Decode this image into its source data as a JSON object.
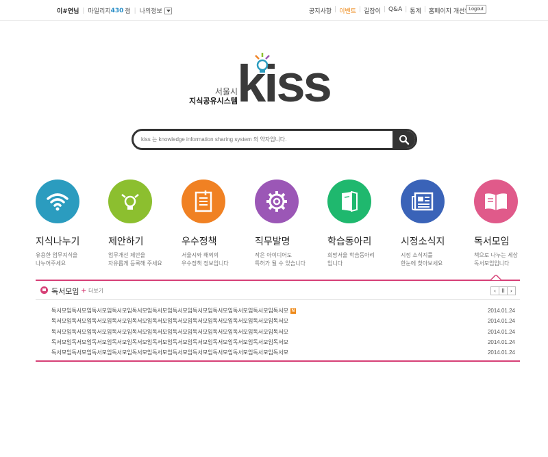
{
  "topbar": {
    "user_name": "이#연님",
    "mileage_label": "마일리지",
    "mileage_value": "430",
    "mileage_unit": "점",
    "myinfo_label": "나의정보",
    "nav": [
      "공지사항",
      "이벤트",
      "길잡이",
      "Q&A",
      "통계",
      "홈페이지 개선의견"
    ],
    "logout_label": "Logout",
    "colors": {
      "active": "#ee8a1a",
      "points": "#2a8ec7"
    }
  },
  "logo": {
    "sub1": "서울시",
    "sub2": "지식공유시스템",
    "word": "kiss"
  },
  "search": {
    "placeholder": "kiss 는 knowledge information sharing system 의 약자입니다."
  },
  "categories": [
    {
      "title": "지식나누기",
      "desc1": "유용한 업무지식을",
      "desc2": "나누어주세요",
      "color": "#2b9cbf",
      "icon": "wifi-icon"
    },
    {
      "title": "제안하기",
      "desc1": "업무개선 제안을",
      "desc2": "자유롭게 등록해 주세요",
      "color": "#8cbf2f",
      "icon": "lightbulb-icon"
    },
    {
      "title": "우수정책",
      "desc1": "서울시와 해외의",
      "desc2": "우수정책 정보입니다",
      "color": "#f08123",
      "icon": "document-icon"
    },
    {
      "title": "직무발명",
      "desc1": "작은 아이디어도",
      "desc2": "특허가 될 수 있습니다",
      "color": "#9b57b6",
      "icon": "gear-icon"
    },
    {
      "title": "학습동아리",
      "desc1": "희망서울 학습동아리",
      "desc2": "입니다",
      "color": "#1fb86e",
      "icon": "book-icon"
    },
    {
      "title": "시정소식지",
      "desc1": "시정 소식지를",
      "desc2": "한눈에 찾아보세요",
      "color": "#3a63b8",
      "icon": "newspaper-icon"
    },
    {
      "title": "독서모임",
      "desc1": "책으로 나누는 세상",
      "desc2": "독서모임입니다",
      "color": "#e05a8a",
      "icon": "open-book-icon"
    }
  ],
  "panel": {
    "title": "독서모임",
    "more_plus": "+",
    "more_label": "더보기",
    "pager": [
      "‹",
      "II",
      "›"
    ],
    "new_badge": "N",
    "accent": "#d63f76",
    "items": [
      {
        "text": "독서모임독서모임독서모임독서모임독서모임독서모임독서모임독서모임독서모임독서모임독서모임독서모",
        "date": "2014.01.24",
        "is_new": true
      },
      {
        "text": "독서모임독서모임독서모임독서모임독서모임독서모임독서모임독서모임독서모임독서모임독서모임독서모",
        "date": "2014.01.24",
        "is_new": false
      },
      {
        "text": "독서모임독서모임독서모임독서모임독서모임독서모임독서모임독서모임독서모임독서모임독서모임독서모",
        "date": "2014.01.24",
        "is_new": false
      },
      {
        "text": "독서모임독서모임독서모임독서모임독서모임독서모임독서모임독서모임독서모임독서모임독서모임독서모",
        "date": "2014.01.24",
        "is_new": false
      },
      {
        "text": "독서모임독서모임독서모임독서모임독서모임독서모임독서모임독서모임독서모임독서모임독서모임독서모",
        "date": "2014.01.24",
        "is_new": false
      }
    ]
  }
}
